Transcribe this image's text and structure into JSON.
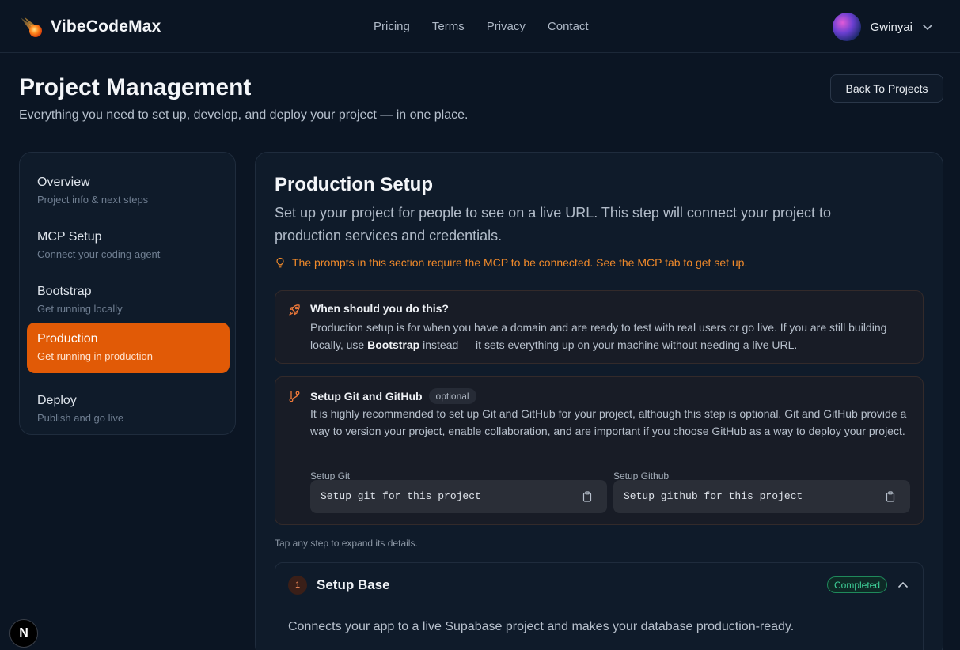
{
  "brand": {
    "name": "VibeCodeMax",
    "logo_icon": "comet-icon"
  },
  "nav": [
    "Pricing",
    "Terms",
    "Privacy",
    "Contact"
  ],
  "user": {
    "name": "Gwinyai"
  },
  "page": {
    "title": "Project Management",
    "subtitle": "Everything you need to set up, develop, and deploy your project — in one place.",
    "back_label": "Back To Projects"
  },
  "sidebar": {
    "items": [
      {
        "title": "Overview",
        "desc": "Project info & next steps",
        "active": false
      },
      {
        "title": "MCP Setup",
        "desc": "Connect your coding agent",
        "active": false
      },
      {
        "title": "Bootstrap",
        "desc": "Get running locally",
        "active": false
      },
      {
        "title": "Production",
        "desc": "Get running in production",
        "active": true
      },
      {
        "title": "Deploy",
        "desc": "Publish and go live",
        "active": false
      }
    ]
  },
  "main": {
    "title": "Production Setup",
    "desc": "Set up your project for people to see on a live URL. This step will connect your project to production services and credentials.",
    "warning": "The prompts in this section require the MCP to be connected. See the MCP tab to get set up.",
    "when": {
      "title": "When should you do this?",
      "text_before": "Production setup is for when you have a domain and are ready to test with real users or go live. If you are still building locally, use ",
      "text_bold": "Bootstrap",
      "text_after": " instead — it sets everything up on your machine without needing a live URL."
    },
    "git": {
      "title": "Setup Git and GitHub",
      "badge": "optional",
      "text": "It is highly recommended to set up Git and GitHub for your project, although this step is optional. Git and GitHub provide a way to version your project, enable collaboration, and are important if you choose GitHub as a way to deploy your project.",
      "git_label": "Setup Git",
      "git_cmd": "Setup git for this project",
      "github_label": "Setup Github",
      "github_cmd": "Setup github for this project"
    },
    "hint": "Tap any step to expand its details.",
    "step1": {
      "number": "1",
      "title": "Setup Base",
      "status": "Completed",
      "body": "Connects your app to a live Supabase project and makes your database production-ready."
    }
  },
  "floating_badge": "N",
  "colors": {
    "accent": "#e15a06",
    "warning": "#f08a2a",
    "success": "#3fd199",
    "background": "#0b1523"
  }
}
